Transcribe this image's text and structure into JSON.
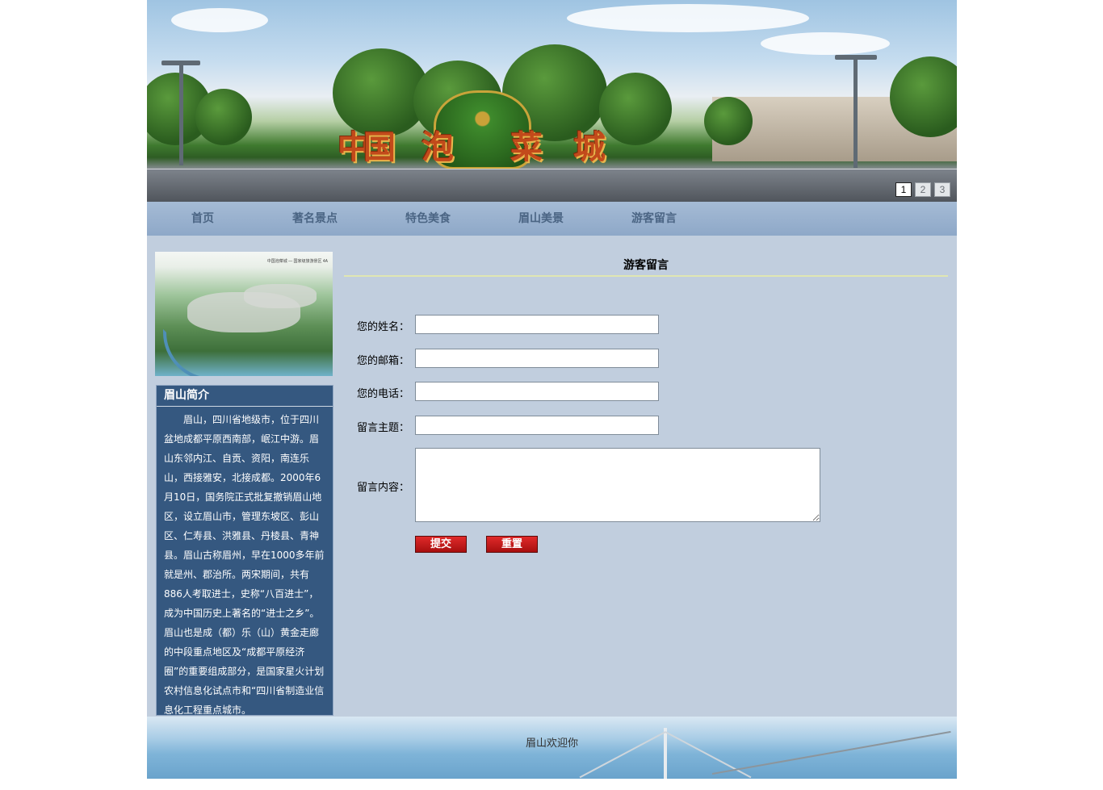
{
  "banner": {
    "logo_chars": [
      "中",
      "国",
      "泡",
      "菜",
      "城"
    ],
    "slides": [
      "1",
      "2",
      "3"
    ],
    "active_slide": 0
  },
  "nav": {
    "items": [
      "首页",
      "著名景点",
      "特色美食",
      "眉山美景",
      "游客留言"
    ]
  },
  "sidebar": {
    "image_caption": "中国泡菜城 — 国家级旅游景区 4A",
    "intro_title": "眉山简介",
    "intro_text": "眉山，四川省地级市，位于四川盆地成都平原西南部，岷江中游。眉山东邻内江、自贡、资阳，南连乐山，西接雅安，北接成都。2000年6月10日，国务院正式批复撤销眉山地区，设立眉山市，管理东坡区、彭山区、仁寿县、洪雅县、丹棱县、青神县。眉山古称眉州，早在1000多年前就是州、郡治所。两宋期间，共有886人考取进士，史称“八百进士”，成为中国历史上著名的“进士之乡”。 眉山也是成（都）乐（山）黄金走廊的中段重点地区及“成都平原经济圈”的重要组成部分，是国家星火计划农村信息化试点市和“四川省制造业信息化工程重点城市。"
  },
  "form": {
    "title": "游客留言",
    "name_label": "您的姓名：",
    "email_label": "您的邮箱：",
    "phone_label": "您的电话：",
    "subject_label": "留言主题：",
    "content_label": "留言内容：",
    "name_value": "",
    "email_value": "",
    "phone_value": "",
    "subject_value": "",
    "content_value": "",
    "submit_label": "提交",
    "reset_label": "重置"
  },
  "footer": {
    "text": "眉山欢迎你"
  },
  "colors": {
    "page_bg": "#c1cede",
    "nav_text": "#4b6584",
    "intro_bg": "#355880",
    "button_red": "#c81a1a"
  }
}
